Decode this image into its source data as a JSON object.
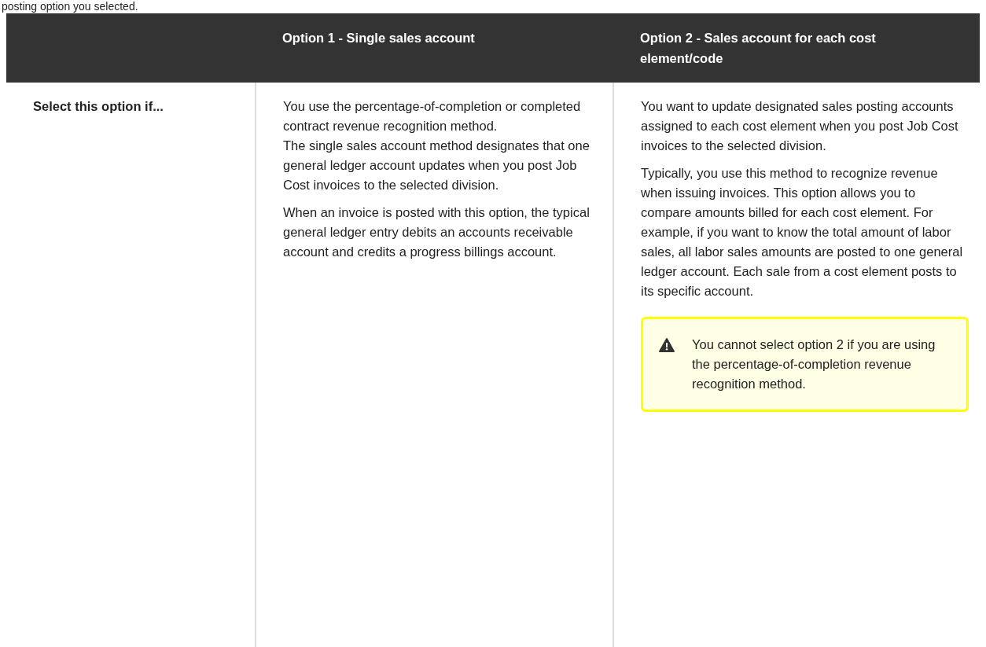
{
  "intro_text": "posting option you selected.",
  "table": {
    "columns": [
      null,
      "Option 1 - Single sales account",
      "Option 2 - Sales account for each cost element/code"
    ],
    "rows": [
      {
        "cells": [
          {
            "kind": "row_header",
            "text": "Select this option if..."
          },
          {
            "kind": "body",
            "paragraphs": [
              {
                "lines": [
                  "You use the percentage-of-completion or completed contract revenue recognition method.",
                  "The single sales account method designates that one general ledger account updates when you post Job Cost invoices to the selected division."
                ]
              },
              {
                "lines": [
                  "When an invoice is posted with this option, the typical general ledger entry debits an accounts receivable account and credits a progress billings account."
                ]
              }
            ]
          },
          {
            "kind": "body",
            "paragraphs": [
              {
                "lines": [
                  "You want to update designated sales posting accounts assigned to each cost element when you post Job Cost invoices to the selected division."
                ]
              },
              {
                "lines": [
                  "Typically, you use this method to recognize revenue when issuing invoices. This option allows you to compare amounts billed for each cost element. For example, if you want to know the total amount of labor sales, all labor sales amounts are posted to one general ledger account. Each sale from a cost element posts to its specific account."
                ]
              }
            ],
            "note": {
              "kind": "warning",
              "text": "You cannot select option 2 if you are using the percentage-of-completion revenue recognition method."
            }
          }
        ]
      }
    ]
  }
}
